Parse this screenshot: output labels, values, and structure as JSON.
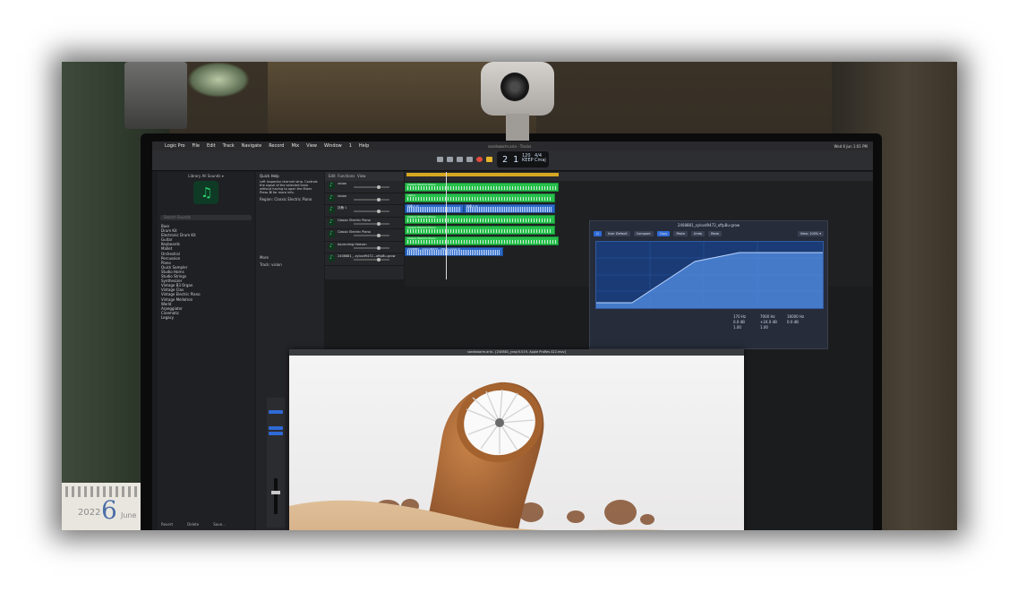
{
  "scene": {
    "description_tags": [
      "monitor",
      "webcam",
      "daw",
      "video-player"
    ],
    "colors": {
      "region_green": "#27c04c",
      "region_blue": "#2d6ac9",
      "eq_blue": "#1a3b75",
      "record_red": "#e24b3f"
    }
  },
  "menubar": {
    "items": [
      "Logic Pro",
      "File",
      "Edit",
      "Track",
      "Navigate",
      "Record",
      "Mix",
      "View",
      "Window",
      "1",
      "Help"
    ],
    "status": "Wed 6 Jun 1:01 PM"
  },
  "window_title": "sandsworm.aria - Tracks",
  "lcd": {
    "bar": "2 1",
    "tempo": "120",
    "keep": "KEEP",
    "sig": "4/4",
    "key": "Cmaj"
  },
  "library": {
    "header": "Library   All Sounds ▾",
    "search_placeholder": "Search Sounds",
    "items": [
      "Bass",
      "Drum Kit",
      "Electronic Drum Kit",
      "Guitar",
      "Keyboards",
      "Mallet",
      "Orchestral",
      "Percussion",
      "Piano",
      "Quick Sampler",
      "Studio Horns",
      "Studio Strings",
      "Synthesizer",
      "Vintage B3 Organ",
      "Vintage Clav",
      "Vintage Electric Piano",
      "Vintage Mellotron",
      "World",
      "Arpeggiator",
      "Cinematic",
      "Legacy"
    ],
    "footer": [
      "Revert",
      "Delete",
      "Save..."
    ]
  },
  "inspector": {
    "quick_help": "Quick Help",
    "help_text": "Left Inspector channel strip. Controls the signal of the selected track without having to open the Mixer. Press ⌘ for more info.",
    "region_label": "Region: Classic Electric Piano",
    "track_label": "Track: vision",
    "more_label": "More"
  },
  "tracks": {
    "header_items": [
      "Edit",
      "Functions",
      "View"
    ],
    "list": [
      {
        "name": "vision"
      },
      {
        "name": "vision"
      },
      {
        "name": "扶桑·1"
      },
      {
        "name": "Classic Electric Piano"
      },
      {
        "name": "Classic Electric Piano"
      },
      {
        "name": "Ascending Heaven"
      },
      {
        "name": "2408881_..zylovd9472...oftpBu-grow"
      }
    ]
  },
  "arrange": {
    "snap": "Smart",
    "drag": "No Overlap",
    "regions": [
      {
        "label": "Classic Electric Piano",
        "kind": "midi"
      },
      {
        "label": "vision",
        "kind": "midi"
      },
      {
        "label": "扶桑·1 ◎",
        "kind": "audio"
      },
      {
        "label": "扶桑·1 ◎",
        "kind": "audio"
      },
      {
        "label": "Classic Electric Piano",
        "kind": "midi"
      },
      {
        "label": "Classic Electric Piano",
        "kind": "midi"
      },
      {
        "label": "Classic Electric Piano",
        "kind": "midi"
      },
      {
        "label": "2408881_..zylovd9472...oftpBu-grow ◎",
        "kind": "audio"
      }
    ]
  },
  "eq_plugin": {
    "title": "2408881_zylovd9472_oftpBu-grow",
    "preset": "User Default",
    "tabs": [
      "Compare",
      "Copy",
      "Paste",
      "Undo",
      "Redo"
    ],
    "view": "View: 100% ▾",
    "readouts": [
      "170 Hz",
      "7000 Hz",
      "16000 Hz",
      "0.0 dB",
      "+24.0 dB",
      "0.0 dB",
      "1.00",
      "1.00"
    ]
  },
  "video_window": {
    "title": "sandsworm.aria - [240881_yrag·0.019- Apple ProRes 422.mov]"
  }
}
